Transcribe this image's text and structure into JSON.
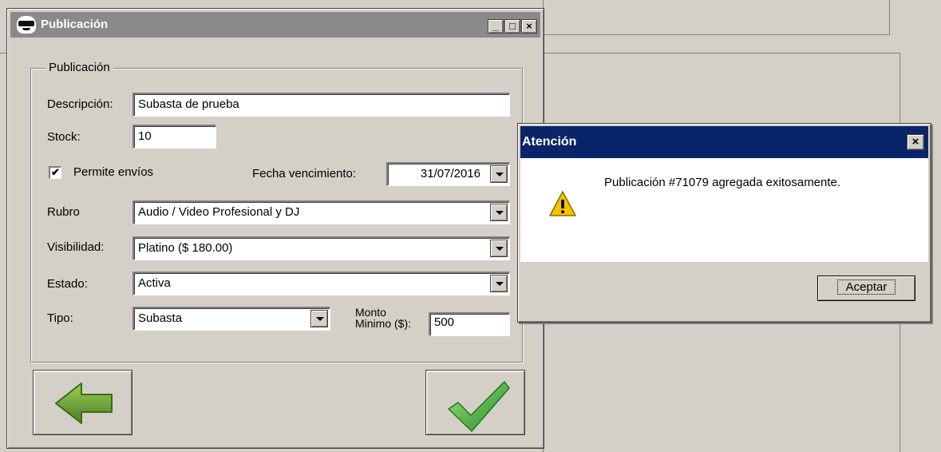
{
  "window": {
    "title": "Publicación",
    "minimize": "_",
    "maximize": "□",
    "close": "×"
  },
  "group": {
    "legend": "Publicación"
  },
  "form": {
    "descripcion_label": "Descripción:",
    "descripcion_value": "Subasta de prueba",
    "stock_label": "Stock:",
    "stock_value": "10",
    "permite_envios_label": "Permite envíos",
    "permite_envios_checked": true,
    "fecha_label": "Fecha vencimiento:",
    "fecha_value": "31/07/2016",
    "rubro_label": "Rubro",
    "rubro_value": "Audio / Video Profesional y DJ",
    "visibilidad_label": "Visibilidad:",
    "visibilidad_value": "Platino ($ 180.00)",
    "estado_label": "Estado:",
    "estado_value": "Activa",
    "tipo_label": "Tipo:",
    "tipo_value": "Subasta",
    "monto_label_line1": "Monto",
    "monto_label_line2": "Minimo ($):",
    "monto_value": "500"
  },
  "buttons": {
    "back_icon": "back-arrow-icon",
    "confirm_icon": "checkmark-icon"
  },
  "dialog": {
    "title": "Atención",
    "close": "×",
    "icon": "warning-icon",
    "message": "Publicación #71079 agregada exitosamente.",
    "ok_label": "Aceptar"
  },
  "colors": {
    "dialog_title_bg": "#0a246a",
    "window_title_bg": "#8a8a8a",
    "arrow_green": "#5f9a2c",
    "check_green": "#3aa03a",
    "warning_yellow": "#f5c400"
  }
}
